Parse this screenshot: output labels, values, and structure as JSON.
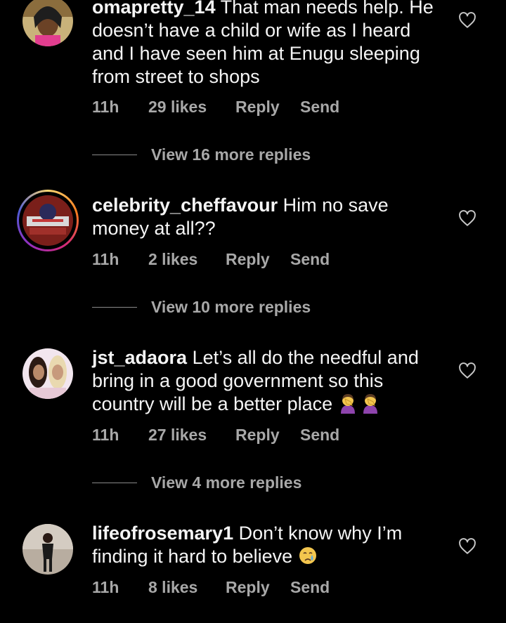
{
  "comments": [
    {
      "username": "omapretty_14",
      "text": "That man needs help. He doesn’t have a child or wife as I heard and I have seen him at Enugu sleeping from street to shops",
      "time": "11h",
      "likes": "29 likes",
      "reply": "Reply",
      "send": "Send",
      "view_replies": "View 16 more replies"
    },
    {
      "username": "celebrity_cheffavour",
      "text": "Him no save money at all??",
      "time": "11h",
      "likes": "2 likes",
      "reply": "Reply",
      "send": "Send",
      "view_replies": "View 10 more replies"
    },
    {
      "username": "jst_adaora",
      "text": "Let’s all do the needful and bring in a good government so this country will be a better place",
      "time": "11h",
      "likes": "27 likes",
      "reply": "Reply",
      "send": "Send",
      "view_replies": "View 4 more replies",
      "emoji": [
        "woman-facepalming",
        "woman-facepalming"
      ]
    },
    {
      "username": "lifeofrosemary1",
      "text": "Don’t know why I’m finding it hard to believe",
      "time": "11h",
      "likes": "8 likes",
      "reply": "Reply",
      "send": "Send",
      "emoji": [
        "crying-face"
      ]
    }
  ],
  "colors": {
    "background": "#000000",
    "text": "#f5f5f5",
    "secondary": "#a8a8a8"
  },
  "icons": {
    "like": "heart-outline-icon"
  }
}
